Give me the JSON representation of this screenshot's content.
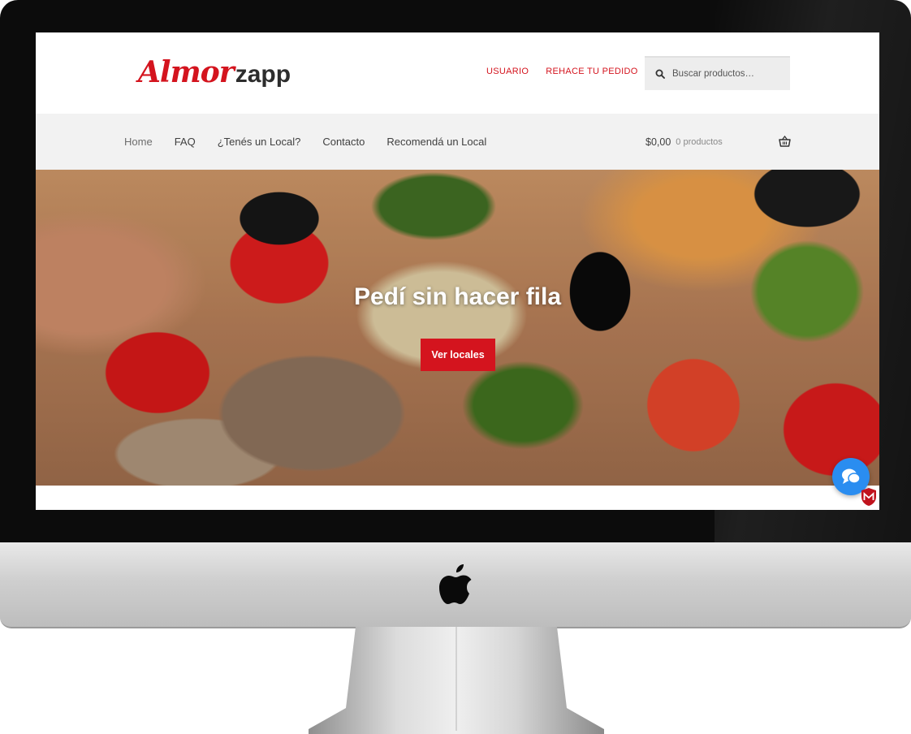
{
  "brand": {
    "logo_script": "Almor",
    "logo_rest": "zapp",
    "accent_color": "#d4141e"
  },
  "topnav": {
    "items": [
      {
        "label": "USUARIO"
      },
      {
        "label": "REHACE TU PEDIDO"
      }
    ]
  },
  "search": {
    "placeholder": "Buscar productos…",
    "icon": "search-icon"
  },
  "mainnav": {
    "items": [
      {
        "label": "Home"
      },
      {
        "label": "FAQ"
      },
      {
        "label": "¿Tenés un Local?"
      },
      {
        "label": "Contacto"
      },
      {
        "label": "Recomendá un Local"
      }
    ]
  },
  "cart": {
    "amount": "$0,00",
    "count": "0 productos",
    "icon": "basket-icon"
  },
  "hero": {
    "title": "Pedí sin hacer fila",
    "button_label": "Ver locales"
  },
  "widgets": {
    "chat_icon": "chat-bubble-icon",
    "security_badge_icon": "shield-badge-icon"
  }
}
